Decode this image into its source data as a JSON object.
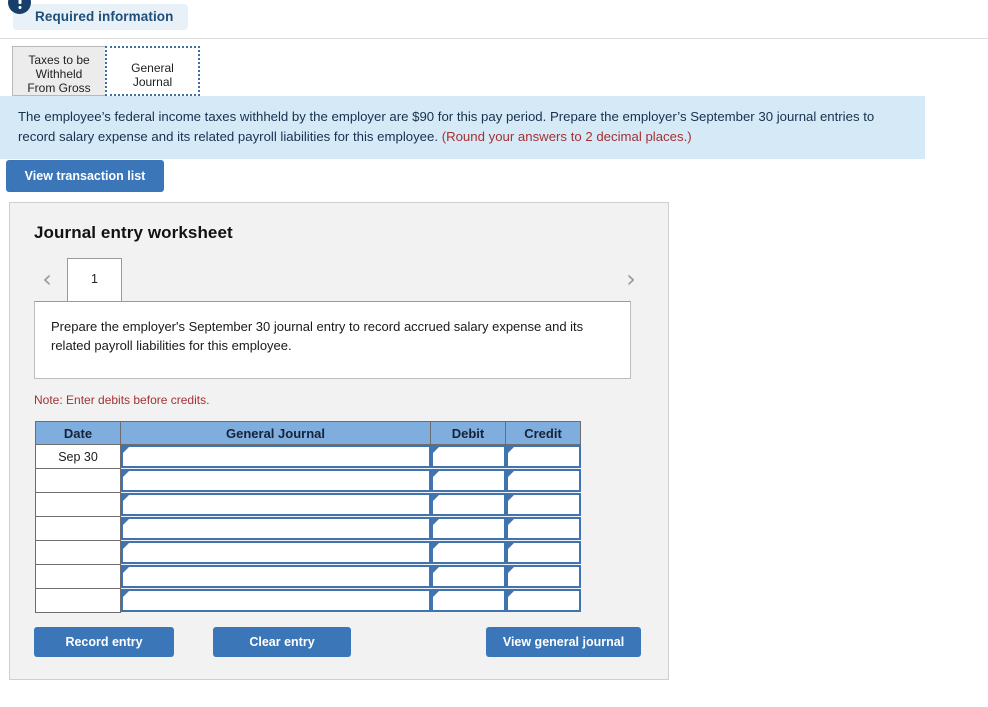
{
  "required_banner": {
    "label": "Required information",
    "icon": "exclamation-circle-icon",
    "pill_bg": "#e8f0f8",
    "icon_color": "#173f6b",
    "text_color": "#1f4e79"
  },
  "tabs": [
    {
      "label": "Taxes to be Withheld From Gross Pay",
      "active": false
    },
    {
      "label": "General Journal",
      "active": true
    }
  ],
  "instruction_banner": {
    "bg": "#d6e9f7",
    "text": "The employee’s federal income taxes withheld by the employer are $90 for this pay period. Prepare the employer’s September 30 journal entries to record salary expense and its related payroll liabilities for this employee.",
    "rounding_note": "(Round your answers to 2 decimal places.)",
    "rounding_note_color": "#a33232"
  },
  "transaction_button": {
    "label": "View transaction list",
    "color": "#3b77b8"
  },
  "worksheet": {
    "title": "Journal entry worksheet",
    "pager": {
      "prev_icon": "chevron-left-icon",
      "next_icon": "chevron-right-icon",
      "current_page": "1"
    },
    "prompt": "Prepare the employer's September 30 journal entry to record accrued salary expense and its related payroll liabilities for this employee.",
    "note": "Note: Enter debits before credits.",
    "note_color": "#a33232",
    "table": {
      "header_bg": "#7fadde",
      "input_border": "#3f74b0",
      "columns": [
        "Date",
        "General Journal",
        "Debit",
        "Credit"
      ],
      "rows": [
        {
          "date": "Sep 30",
          "general_journal": "",
          "debit": "",
          "credit": ""
        },
        {
          "date": "",
          "general_journal": "",
          "debit": "",
          "credit": ""
        },
        {
          "date": "",
          "general_journal": "",
          "debit": "",
          "credit": ""
        },
        {
          "date": "",
          "general_journal": "",
          "debit": "",
          "credit": ""
        },
        {
          "date": "",
          "general_journal": "",
          "debit": "",
          "credit": ""
        },
        {
          "date": "",
          "general_journal": "",
          "debit": "",
          "credit": ""
        },
        {
          "date": "",
          "general_journal": "",
          "debit": "",
          "credit": ""
        }
      ]
    },
    "actions": {
      "record": "Record entry",
      "clear": "Clear entry",
      "view_general_journal": "View general journal"
    }
  }
}
